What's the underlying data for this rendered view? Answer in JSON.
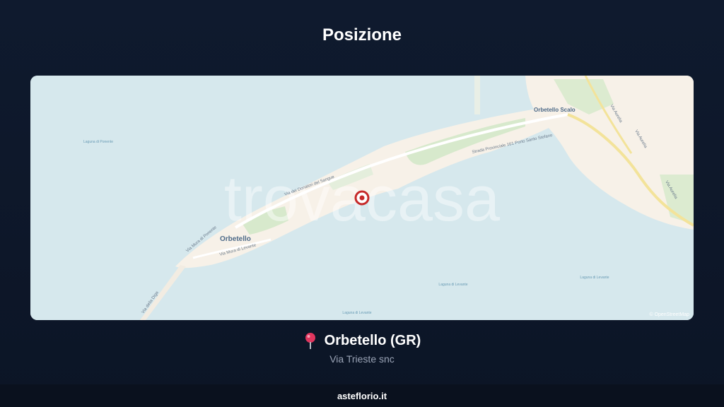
{
  "header": {
    "title": "Posizione"
  },
  "map": {
    "watermark": "trovacasa",
    "attribution": "© OpenStreetMap",
    "labels": {
      "town": "Orbetello",
      "town_scalo": "Orbetello Scalo",
      "laguna_ponente": "Laguna di Ponente",
      "laguna_levante_1": "Laguna di Levante",
      "laguna_levante_2": "Laguna di Levante",
      "laguna_levante_3": "Laguna di Levante",
      "via_donatori": "Via dei Donatori del Sangue",
      "strada_provinciale": "Strada Provinciale 161 Porto Santo Stefano",
      "via_mura_ponente": "Via Mura di Ponente",
      "via_mura_levante": "Via Mura di Levante",
      "via_diga": "Via della Diga",
      "via_aurelia_1": "Via Aurelia",
      "via_aurelia_2": "Via Aurelia",
      "via_aurelia_3": "Via Aurelia"
    },
    "colors": {
      "water": "#d6e8ed",
      "land": "#f7f1e8",
      "green": "#d7e9cc",
      "road": "#ffffff",
      "marker": "#c62a2a"
    },
    "icons": {
      "marker": "map-marker-icon"
    }
  },
  "location": {
    "icon": "pin-icon",
    "city": "Orbetello (GR)",
    "address": "Via Trieste snc"
  },
  "footer": {
    "site": "asteflorio.it"
  }
}
